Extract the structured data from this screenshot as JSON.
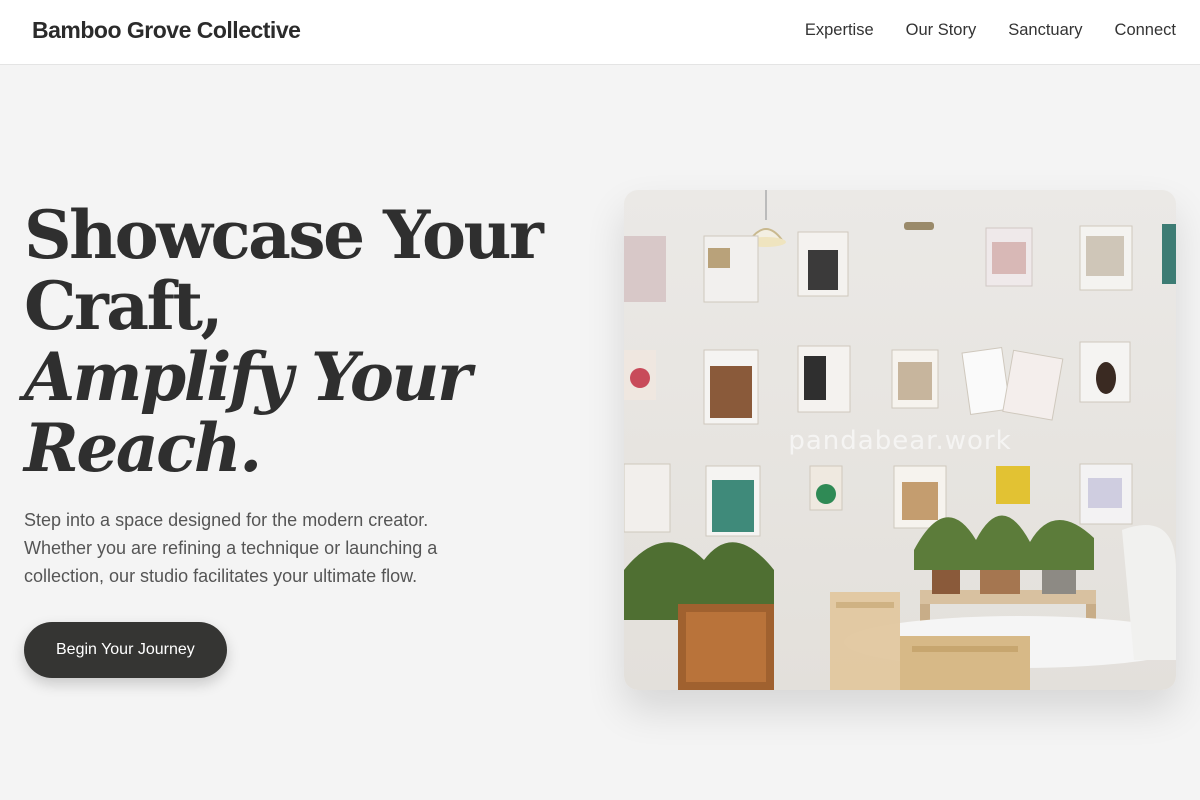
{
  "brand": {
    "name": "Bamboo Grove Collective"
  },
  "nav": {
    "items": [
      {
        "label": "Expertise"
      },
      {
        "label": "Our Story"
      },
      {
        "label": "Sanctuary"
      },
      {
        "label": "Connect"
      }
    ]
  },
  "hero": {
    "headline": {
      "line1": "Showcase Your",
      "line2": "Craft,",
      "line3": "Amplify Your",
      "line4": "Reach."
    },
    "lede": "Step into a space designed for the modern creator. Whether you are refining a technique or launching a collection, our studio facilitates your ultimate flow.",
    "cta_label": "Begin Your Journey"
  },
  "photo": {
    "watermark": "pandabear.work"
  },
  "colors": {
    "background": "#f4f4f4",
    "text": "#2f2f2f",
    "button": "#353533"
  }
}
